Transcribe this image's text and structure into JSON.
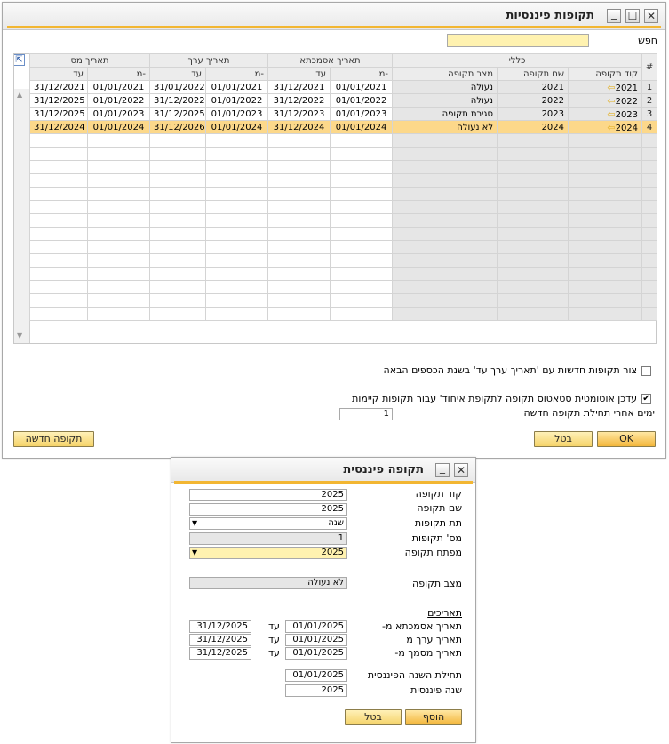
{
  "main_window": {
    "title": "תקופות פיננסיות",
    "search_label": "חפש",
    "search_value": "",
    "group_headers": {
      "general": "כללי",
      "posting": "תאריך אסמכתא",
      "due": "תאריך ערך",
      "tax": "תאריך מס"
    },
    "columns": {
      "row_num": "#",
      "code": "קוד תקופה",
      "name": "שם תקופה",
      "status": "מצב תקופה",
      "from": "מ-",
      "to": "עד"
    },
    "rows": [
      {
        "n": "1",
        "code": "2021",
        "name": "2021",
        "status": "נעולה",
        "p_from": "01/01/2021",
        "p_to": "31/12/2021",
        "d_from": "01/01/2021",
        "d_to": "31/01/2022",
        "t_from": "01/01/2021",
        "t_to": "31/12/2021"
      },
      {
        "n": "2",
        "code": "2022",
        "name": "2022",
        "status": "נעולה",
        "p_from": "01/01/2022",
        "p_to": "31/12/2022",
        "d_from": "01/01/2022",
        "d_to": "31/12/2022",
        "t_from": "01/01/2022",
        "t_to": "31/12/2025"
      },
      {
        "n": "3",
        "code": "2023",
        "name": "2023",
        "status": "סגירת תקופה",
        "p_from": "01/01/2023",
        "p_to": "31/12/2023",
        "d_from": "01/01/2023",
        "d_to": "31/12/2025",
        "t_from": "01/01/2023",
        "t_to": "31/12/2025"
      },
      {
        "n": "4",
        "code": "2024",
        "name": "2024",
        "status": "לא נעולה",
        "p_from": "01/01/2024",
        "p_to": "31/12/2024",
        "d_from": "01/01/2024",
        "d_to": "31/12/2026",
        "t_from": "01/01/2024",
        "t_to": "31/12/2024"
      }
    ],
    "selected_row": 4,
    "checkbox1_label": "צור תקופות חדשות עם 'תאריך ערך עד' בשנת הכספים הבאה",
    "checkbox1_checked": false,
    "checkbox2_label": "עדכן אוטומטית סטאטוס תקופה לתקופת איחוד' עבור תקופות קיימות",
    "checkbox2_checked": true,
    "days_label": "ימים אחרי תחילת תקופה חדשה",
    "days_value": "1",
    "ok_label": "OK",
    "cancel_label": "בטל",
    "new_period_label": "תקופה חדשה"
  },
  "dialog": {
    "title": "תקופה פיננסית",
    "code_label": "קוד תקופה",
    "code_value": "2025",
    "name_label": "שם תקופה",
    "name_value": "2025",
    "subperiods_label": "תת תקופות",
    "subperiods_value": "שנה",
    "num_periods_label": "מס' תקופות",
    "num_periods_value": "1",
    "period_indicator_label": "מפתח תקופה",
    "period_indicator_value": "2025",
    "status_label": "מצב תקופה",
    "status_value": "לא נעולה",
    "dates_header": "תאריכים",
    "to_label": "עד",
    "posting_label": "תאריך אסמכתא מ-",
    "posting_from": "01/01/2025",
    "posting_to": "31/12/2025",
    "due_label": "תאריך ערך מ",
    "due_from": "01/01/2025",
    "due_to": "31/12/2025",
    "doc_label": "תאריך מסמך מ-",
    "doc_from": "01/01/2025",
    "doc_to": "31/12/2025",
    "fy_start_label": "תחילת השנה הפיננסית",
    "fy_start_value": "01/01/2025",
    "fy_label": "שנה פיננסית",
    "fy_value": "2025",
    "add_label": "הוסף",
    "cancel_label": "בטל"
  }
}
